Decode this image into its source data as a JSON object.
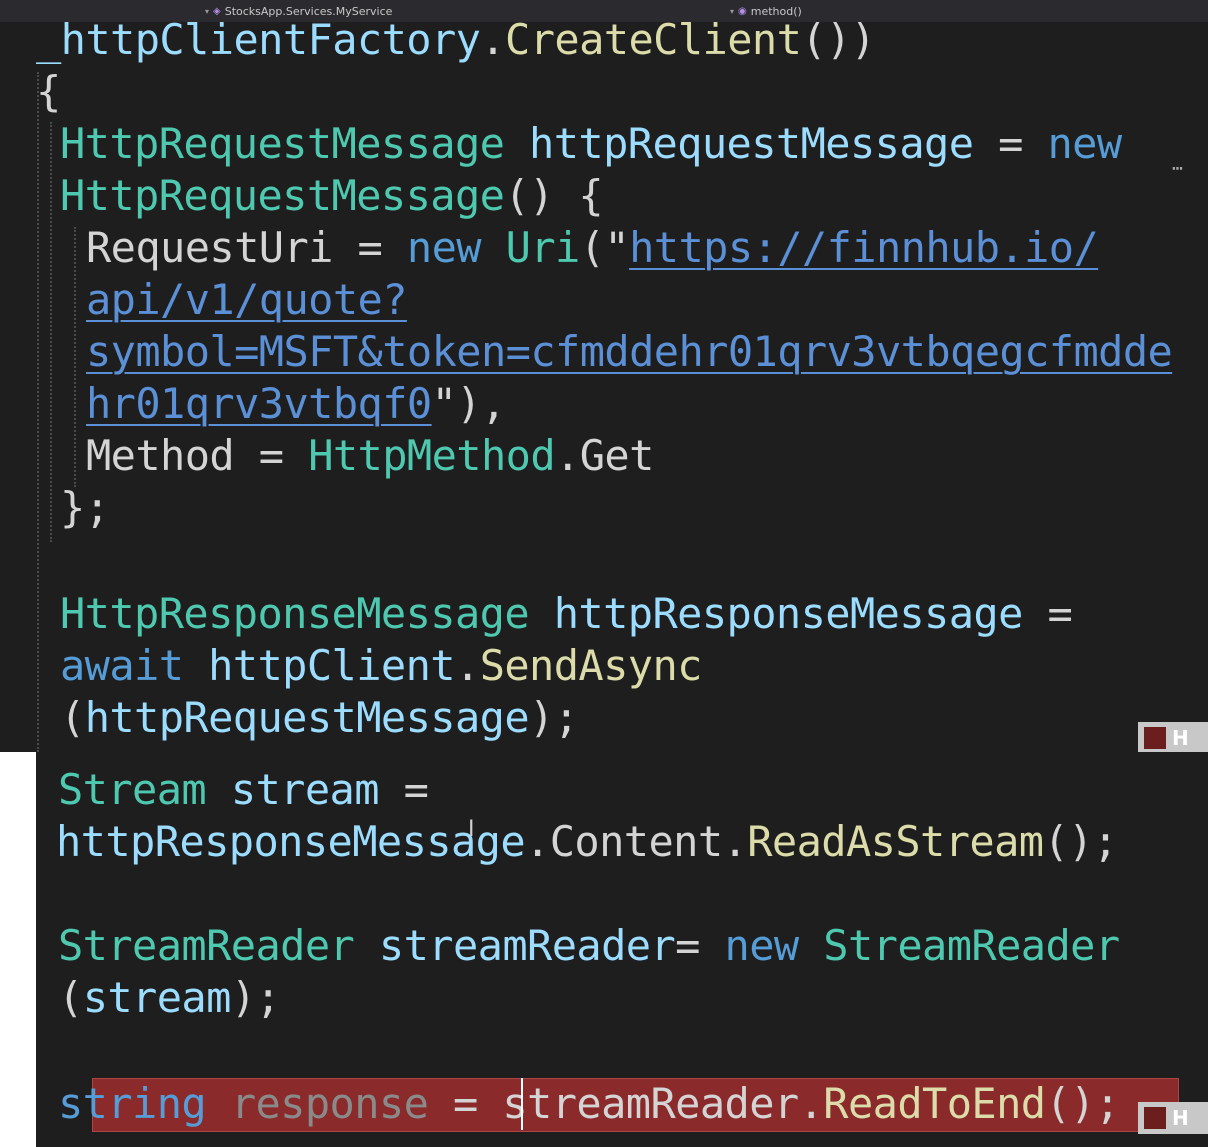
{
  "navbar": {
    "type_crumb": "StocksApp.Services.MyService",
    "member_crumb": "method()"
  },
  "code_panel_1": {
    "lines": [
      [
        {
          "c": "v",
          "t": "_httpClientFactory"
        },
        {
          "c": "p",
          "t": "."
        },
        {
          "c": "m",
          "t": "CreateClient"
        },
        {
          "c": "p",
          "t": "())"
        }
      ],
      [
        {
          "c": "p",
          "t": "{"
        }
      ],
      [
        {
          "c": "t",
          "t": "HttpRequestMessage"
        },
        {
          "c": "p",
          "t": " "
        },
        {
          "c": "v",
          "t": "httpRequestMessage"
        },
        {
          "c": "p",
          "t": " = "
        },
        {
          "c": "k",
          "t": "new"
        }
      ],
      [
        {
          "c": "t",
          "t": "HttpRequestMessage"
        },
        {
          "c": "p",
          "t": "() {"
        }
      ],
      [
        {
          "c": "p",
          "t": "RequestUri = "
        },
        {
          "c": "k",
          "t": "new"
        },
        {
          "c": "p",
          "t": " "
        },
        {
          "c": "t",
          "t": "Uri"
        },
        {
          "c": "p",
          "t": "(\""
        },
        {
          "c": "u",
          "t": "https://finnhub.io/"
        }
      ],
      [
        {
          "c": "u",
          "t": "api/v1/quote?"
        }
      ],
      [
        {
          "c": "u",
          "t": "symbol=MSFT&token=cfmddehr01qrv3vtbqegcfmdde"
        }
      ],
      [
        {
          "c": "u",
          "t": "hr01qrv3vtbqf0"
        },
        {
          "c": "p",
          "t": "\"),"
        }
      ],
      [
        {
          "c": "p",
          "t": "Method = "
        },
        {
          "c": "t",
          "t": "HttpMethod"
        },
        {
          "c": "p",
          "t": "."
        },
        {
          "c": "p",
          "t": "Get"
        }
      ],
      [
        {
          "c": "p",
          "t": "};"
        }
      ],
      [],
      [
        {
          "c": "t",
          "t": "HttpResponseMessage"
        },
        {
          "c": "p",
          "t": " "
        },
        {
          "c": "v",
          "t": "httpResponseMessage"
        },
        {
          "c": "p",
          "t": " ="
        }
      ],
      [
        {
          "c": "k",
          "t": "await"
        },
        {
          "c": "p",
          "t": " "
        },
        {
          "c": "v",
          "t": "httpClient"
        },
        {
          "c": "p",
          "t": "."
        },
        {
          "c": "m",
          "t": "SendAsync"
        }
      ],
      [
        {
          "c": "p",
          "t": "("
        },
        {
          "c": "v",
          "t": "httpRequestMessage"
        },
        {
          "c": "p",
          "t": ");"
        }
      ]
    ]
  },
  "code_panel_2": {
    "lines": [
      [
        {
          "c": "t",
          "t": "Stream"
        },
        {
          "c": "p",
          "t": " "
        },
        {
          "c": "v",
          "t": "stream"
        },
        {
          "c": "p",
          "t": " ="
        }
      ],
      [
        {
          "c": "v",
          "t": "httpResponseMessage"
        },
        {
          "c": "p",
          "t": "."
        },
        {
          "c": "p",
          "t": "Content"
        },
        {
          "c": "p",
          "t": "."
        },
        {
          "c": "m",
          "t": "ReadAsStream"
        },
        {
          "c": "p",
          "t": "();"
        }
      ],
      [],
      [
        {
          "c": "t",
          "t": "StreamReader"
        },
        {
          "c": "p",
          "t": " "
        },
        {
          "c": "v",
          "t": "streamReader"
        },
        {
          "c": "p",
          "t": "= "
        },
        {
          "c": "k",
          "t": "new"
        },
        {
          "c": "p",
          "t": " "
        },
        {
          "c": "t",
          "t": "StreamReader"
        }
      ],
      [
        {
          "c": "p",
          "t": "("
        },
        {
          "c": "v",
          "t": "stream"
        },
        {
          "c": "p",
          "t": ");"
        }
      ],
      [],
      [
        {
          "c": "k",
          "t": "string"
        },
        {
          "c": "p",
          "t": " "
        },
        {
          "c": "dim",
          "t": "response"
        },
        {
          "c": "p",
          "t": " = "
        },
        {
          "c": "p",
          "t": "streamReader"
        },
        {
          "c": "p",
          "t": "."
        },
        {
          "c": "m",
          "t": "ReadToEnd"
        },
        {
          "c": "p",
          "t": "();"
        }
      ]
    ]
  },
  "watermark_letter": "H",
  "colors": {
    "editor_bg": "#1e1e1e",
    "type": "#4ec9b0",
    "keyword": "#569cd6",
    "variable": "#9cdcfe",
    "method": "#dcdcaa",
    "link": "#5b8fd6",
    "highlight": "#8a2a2a"
  }
}
